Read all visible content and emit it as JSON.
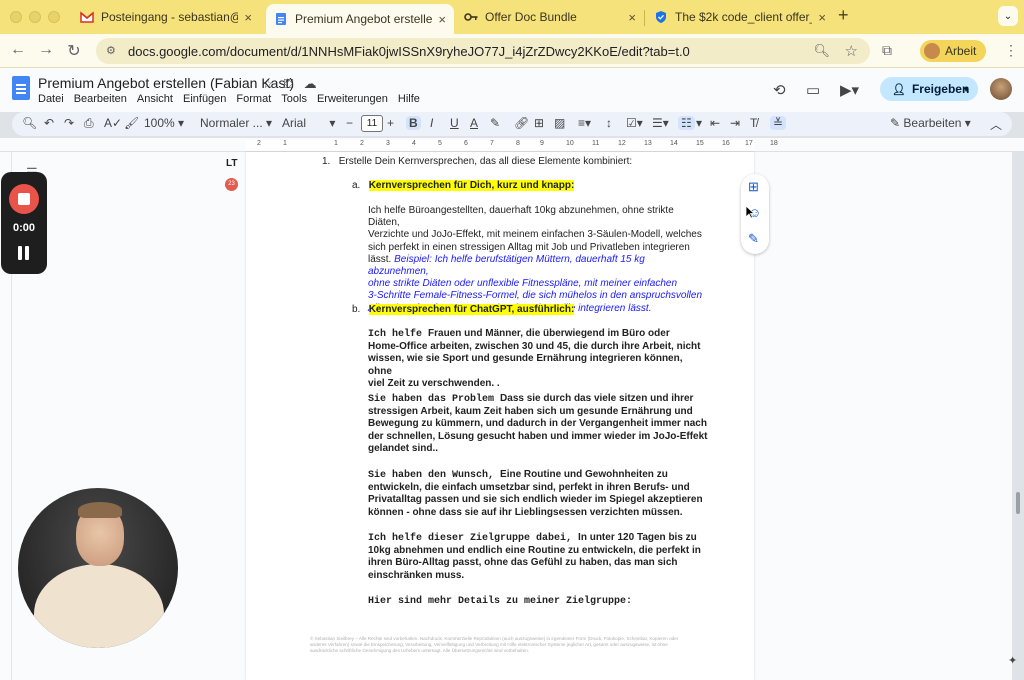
{
  "browser": {
    "tabs": [
      {
        "label": "Posteingang - sebastian@sie",
        "favicon": "gmail-icon",
        "active": false
      },
      {
        "label": "Premium Angebot erstellen (F",
        "favicon": "docs-icon",
        "active": true
      },
      {
        "label": "Offer Doc Bundle",
        "favicon": "key-icon",
        "active": false
      },
      {
        "label": "The $2k code_client offer_st",
        "favicon": "shield-icon",
        "active": false
      }
    ],
    "url": "docs.google.com/document/d/1NNHsMFiak0jwISSnX9ryheJO77J_i4jZrZDwcy2KKoE/edit?tab=t.0",
    "profile_label": "Arbeit"
  },
  "docs": {
    "title": "Premium Angebot erstellen (Fabian Kast)",
    "menu": [
      "Datei",
      "Bearbeiten",
      "Ansicht",
      "Einfügen",
      "Format",
      "Tools",
      "Erweiterungen",
      "Hilfe"
    ],
    "share_label": "Freigeben",
    "toolbar": {
      "zoom": "100%",
      "style": "Normaler ...",
      "font": "Arial",
      "font_size": "11",
      "mode": "Bearbeiten"
    }
  },
  "recorder": {
    "time": "0:00"
  },
  "grammar_badge": "23",
  "ruler_numbers": [
    "2",
    "1",
    "1",
    "2",
    "3",
    "4",
    "5",
    "6",
    "7",
    "8",
    "9",
    "10",
    "11",
    "12",
    "13",
    "14",
    "15",
    "16",
    "17",
    "18"
  ],
  "content": {
    "item1": "Erstelle Dein Kernversprechen, das all diese Elemente kombiniert:",
    "a_heading": "Kernversprechen für Dich, kurz und knapp:",
    "a_body_lines": [
      "Ich helfe Büroangestellten, dauerhaft 10kg abzunehmen,  ohne strikte Diäten,",
      "Verzichte und JoJo-Effekt, mit meinem einfachen 3-Säulen-Modell, welches",
      "sich perfekt in einen stressigen Alltag mit Job und Privatleben integrieren",
      "lässt."
    ],
    "a_example_lines": [
      "Beispiel: Ich helfe berufstätigen Müttern, dauerhaft 15 kg abzunehmen,",
      "ohne strikte Diäten oder unflexible Fitnesspläne, mit meiner einfachen",
      "3-Schritte Female-Fitness-Formel, die sich mühelos in den anspruchsvollen",
      "Alltag berufstätiger Frauen mit Job und Familie integrieren lässt."
    ],
    "b_heading": "Kernversprechen für ChatGPT, ausführlich:",
    "p1_lead": "Ich helfe ",
    "p1_lines": [
      " Frauen und Männer, die überwiegend im Büro oder",
      "Home-Office arbeiten, zwischen 30 und 45, die durch ihre Arbeit, nicht",
      "wissen, wie sie Sport und gesunde Ernährung integrieren können, ohne",
      "viel Zeit zu verschwenden. ."
    ],
    "p2_lead": "Sie haben das Problem ",
    "p2_lines": [
      "Dass sie durch das viele sitzen und ihrer",
      "stressigen Arbeit, kaum Zeit haben sich um gesunde Ernährung und",
      "Bewegung zu kümmern, und dadurch in der Vergangenheit immer nach",
      "der schnellen, Lösung gesucht haben und immer wieder im JoJo-Effekt",
      "gelandet sind.."
    ],
    "p3_lead": "Sie haben den Wunsch, ",
    "p3_lines": [
      "Eine Routine und Gewohnheiten zu",
      "entwickeln, die einfach umsetzbar sind, perfekt in ihren Berufs- und",
      "Privatalltag passen und sie sich endlich wieder im Spiegel akzeptieren",
      "können - ohne dass sie auf ihr Lieblingsessen verzichten müssen."
    ],
    "p4_lead": "Ich helfe dieser Zielgruppe dabei, ",
    "p4_lines": [
      "In unter 120 Tagen bis zu",
      "10kg abnehmen und endlich eine Routine zu entwickeln, die perfekt in",
      "ihren Büro-Alltag passt, ohne das Gefühl zu haben, das man sich",
      "einschränken muss."
    ],
    "p5": "Hier sind mehr Details zu meiner Zielgruppe:",
    "footer": "© Sebastian Sieilbrey – Alle Rechte sind vorbehalten. Nachdruck, Kommerzielle Reproduktion (auch auszugsweise) in irgendeiner Form (Druck, Fotokopie, Scheinbar, Kopieren oder anderes Verfahren) sowie die Einspeicherung, Verarbeitung, Vervielfältigung und Verbreitung mit Hilfe elektronischer Systeme jeglicher Art, gesamt oder auszugsweise, ist ohne ausdrückliche schriftliche Genehmigung des Urhebers untersagt. Alle Übersetzungsrechte sind vorbehalten."
  }
}
